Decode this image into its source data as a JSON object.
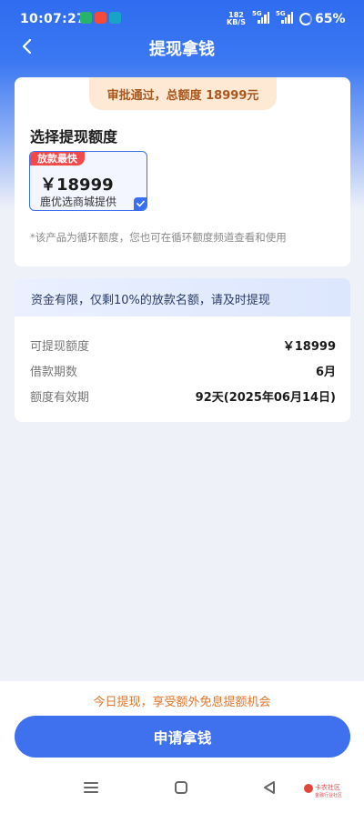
{
  "status_bar": {
    "time": "10:07:27",
    "net_speed_top": "182",
    "net_speed_bottom": "KB/S",
    "signal1_label": "5G",
    "signal2_label": "5G",
    "battery": "65%"
  },
  "header": {
    "title": "提现拿钱",
    "back_icon": "chevron-left-icon"
  },
  "approval": {
    "banner": "审批通过，总额度 18999元"
  },
  "amount_section": {
    "title": "选择提现额度",
    "option": {
      "tag": "放款最快",
      "amount": "￥18999",
      "provider": "鹿优选商城提供",
      "selected": true
    },
    "note": "*该产品为循环额度，您也可在循环额度频道查看和使用"
  },
  "details": {
    "banner": "资金有限，仅剩10%的放款名额，请及时提现",
    "rows": [
      {
        "label": "可提现额度",
        "value": "￥18999"
      },
      {
        "label": "借款期数",
        "value": "6月"
      },
      {
        "label": "额度有效期",
        "value": "92天(2025年06月14日)"
      }
    ]
  },
  "footer": {
    "promo": "今日提现，享受额外免息提额机会",
    "apply_button": "申请拿钱"
  },
  "watermark": {
    "line1": "卡农社区",
    "line2": "金融行业社区"
  },
  "colors": {
    "primary": "#3f71ef",
    "header_blue": "#2f6cf0",
    "promo_orange": "#e2742a",
    "tag_red": "#f24a4a",
    "banner_brown": "#a9581f"
  }
}
